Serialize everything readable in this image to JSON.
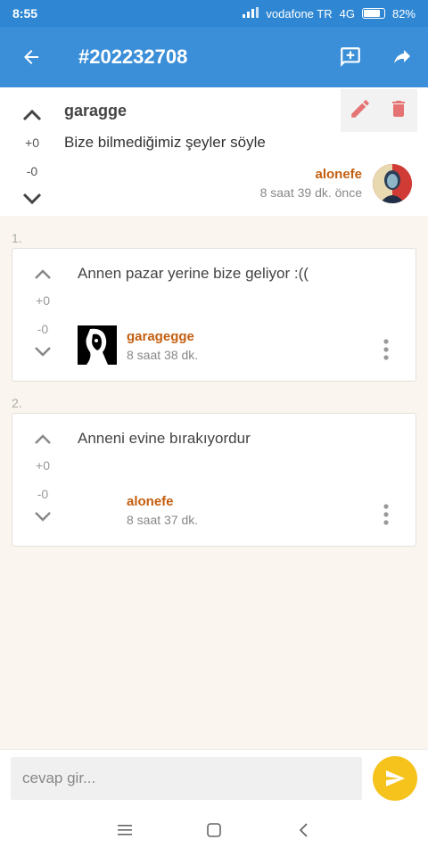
{
  "status": {
    "time": "8:55",
    "carrier": "vodafone TR",
    "network": "4G",
    "battery": "82%",
    "battery_level": 0.82
  },
  "appbar": {
    "title": "#202232708",
    "back_icon": "arrow-left-icon",
    "add_comment_icon": "add-comment-icon",
    "share_icon": "share-icon"
  },
  "post": {
    "title": "garagge",
    "body": "Bize bilmediğimiz şeyler söyle",
    "upvotes": "+0",
    "downvotes": "-0",
    "author": "alonefe",
    "time": "8 saat 39 dk. önce"
  },
  "comments": [
    {
      "index": "1.",
      "text": "Annen pazar yerine bize geliyor :((",
      "upvotes": "+0",
      "downvotes": "-0",
      "author": "garagegge",
      "time": "8 saat 38 dk."
    },
    {
      "index": "2.",
      "text": "Anneni evine bırakıyordur",
      "upvotes": "+0",
      "downvotes": "-0",
      "author": "alonefe",
      "time": "8 saat 37 dk."
    }
  ],
  "reply": {
    "placeholder": "cevap gir..."
  },
  "colors": {
    "appbar": "#3a8fd8",
    "author": "#c45e0f",
    "send": "#f6c21c",
    "delete": "#e57373"
  }
}
